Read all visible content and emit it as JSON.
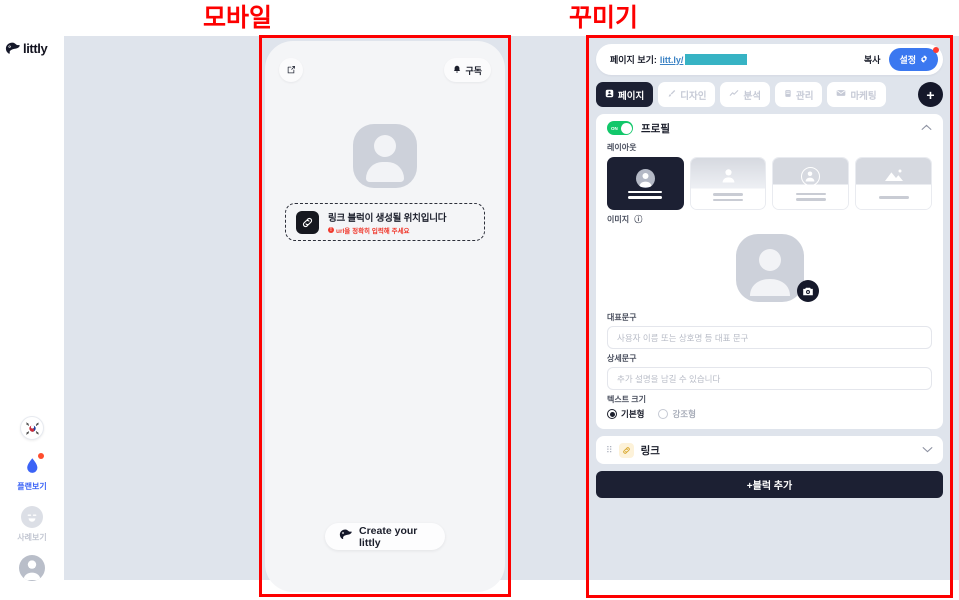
{
  "annotations": {
    "mobile": "모바일",
    "decorate": "꾸미기"
  },
  "brand": {
    "logo_text": "littly",
    "logo_icon": "bird-logo-icon"
  },
  "rail": {
    "items": [
      {
        "label": "",
        "icon": "korea-flag-icon",
        "state": "default"
      },
      {
        "label": "플랜보기",
        "icon": "water-drop-icon",
        "state": "active"
      },
      {
        "label": "사례보기",
        "icon": "smiley-face-icon",
        "state": "dim"
      },
      {
        "label": "",
        "icon": "user-avatar-icon",
        "state": "default"
      }
    ]
  },
  "phone_preview": {
    "share_icon": "external-link-icon",
    "subscribe_label": "구독",
    "subscribe_icon": "bell-icon",
    "avatar_icon": "user-avatar-icon",
    "link_placeholder": {
      "icon": "link-chain-icon",
      "title": "링크 블럭이 생성될 위치입니다",
      "error": "url을 정확히 입력해 주세요",
      "error_icon": "error-exclamation-icon"
    },
    "footer_button": {
      "label": "Create your littly",
      "icon": "bird-logo-icon"
    }
  },
  "editor": {
    "url_bar": {
      "prefix": "페이지 보기:",
      "link": "litt.ly/",
      "redacted": true,
      "copy_label": "복사",
      "settings_label": "설정",
      "settings_icon": "gear-icon",
      "has_notification_dot": true
    },
    "tabs": [
      {
        "label": "페이지",
        "icon": "page-icon",
        "active": true
      },
      {
        "label": "디자인",
        "icon": "brush-icon",
        "active": false
      },
      {
        "label": "분석",
        "icon": "chart-icon",
        "active": false
      },
      {
        "label": "관리",
        "icon": "clipboard-icon",
        "active": false
      },
      {
        "label": "마케팅",
        "icon": "megaphone-icon",
        "active": false
      }
    ],
    "add_button_label": "+",
    "profile_section": {
      "title": "프로필",
      "toggle_on": true,
      "toggle_label": "ON",
      "collapse_icon": "chevron-up-icon",
      "layout_label": "레이아웃",
      "layouts": [
        {
          "name": "centered-avatar",
          "selected": true
        },
        {
          "name": "small-avatar",
          "selected": false
        },
        {
          "name": "outline-avatar",
          "selected": false
        },
        {
          "name": "cover-image",
          "selected": false
        }
      ],
      "image_label": "이미지",
      "image_info_icon": "info-icon",
      "image_camera_icon": "camera-icon",
      "headline_label": "대표문구",
      "headline_placeholder": "사용자 이름 또는 상호명 등 대표 문구",
      "headline_value": "",
      "detail_label": "상세문구",
      "detail_placeholder": "추가 설명을 남길 수 있습니다",
      "detail_value": "",
      "text_size_label": "텍스트 크기",
      "text_size_options": [
        {
          "label": "기본형",
          "selected": true
        },
        {
          "label": "강조형",
          "selected": false
        }
      ]
    },
    "link_section": {
      "title": "링크",
      "grip_icon": "drag-handle-icon",
      "badge_icon": "link-chain-icon",
      "collapse_icon": "chevron-down-icon"
    },
    "add_block_label": "+블럭 추가"
  },
  "colors": {
    "canvas": "#dfe4ec",
    "dark": "#1c2033",
    "accent_blue": "#3b78f0",
    "green": "#12c76a",
    "red": "#fd0000",
    "error": "#f03a2e",
    "teal_redact": "#37b3c4"
  }
}
